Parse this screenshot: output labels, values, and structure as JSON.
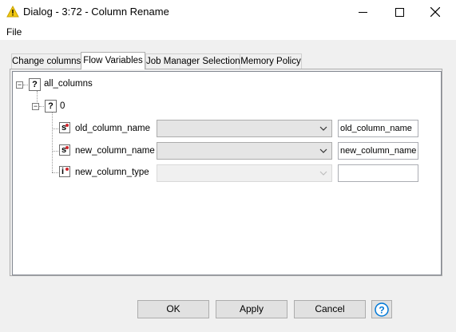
{
  "window": {
    "title": "Dialog - 3:72 - Column Rename",
    "icon": "warning-triangle-icon"
  },
  "menu": {
    "file_label": "File"
  },
  "tabs": [
    {
      "label": "Change columns",
      "active": false
    },
    {
      "label": "Flow Variables",
      "active": true
    },
    {
      "label": "Job Manager Selection",
      "active": false
    },
    {
      "label": "Memory Policy",
      "active": false
    }
  ],
  "tree": {
    "root": {
      "label": "all_columns",
      "icon": "question-icon"
    },
    "child": {
      "label": "0",
      "icon": "question-icon"
    },
    "rows": [
      {
        "label": "old_column_name",
        "type_glyph": "s",
        "combo_value": "",
        "text_value": "old_column_name",
        "enabled": true
      },
      {
        "label": "new_column_name",
        "type_glyph": "s",
        "combo_value": "",
        "text_value": "new_column_name",
        "enabled": true
      },
      {
        "label": "new_column_type",
        "type_glyph": "i",
        "combo_value": "",
        "text_value": "",
        "enabled": false
      }
    ]
  },
  "buttons": {
    "ok_label": "OK",
    "apply_label": "Apply",
    "cancel_label": "Cancel",
    "help_icon": "help-icon"
  },
  "colors": {
    "accent": "#0078d7",
    "warning": "#f2c811",
    "variable_dot": "#d0262d"
  }
}
